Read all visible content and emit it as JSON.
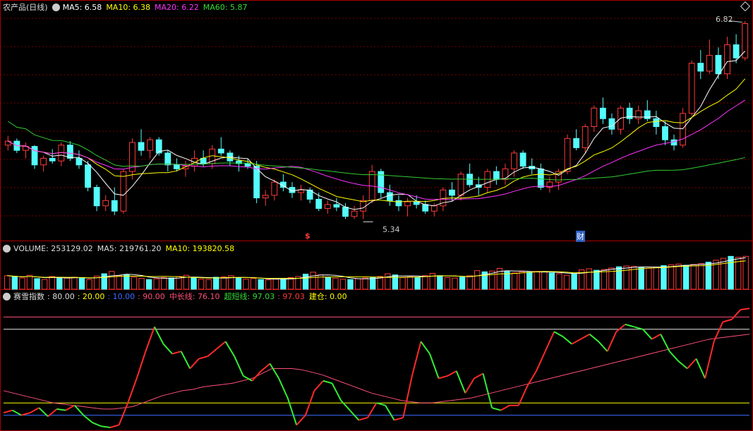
{
  "header": {
    "title": "农产品(日线)",
    "ma5": "MA5: 6.58",
    "ma10": "MA10: 6.38",
    "ma20": "MA20: 6.22",
    "ma60": "MA60: 5.87"
  },
  "volume_header": {
    "title": "VOLUME: 253129.02",
    "ma5": "MA5: 219761.20",
    "ma10": "MA10: 193820.58"
  },
  "indicator_header": {
    "title": "赛雪指数",
    "v1": ": 80.00",
    "v2": ": 20.00",
    "v3": ": 10.00",
    "v4": ": 90.00",
    "mid": "中长线: 76.10",
    "short": "超短线: 97.03",
    "short2": ": 97.03",
    "build": "建仓: 0.00"
  },
  "markers": {
    "dollar": "$",
    "cai": "财"
  },
  "colors": {
    "up": "#ff3a3a",
    "down": "#54fcfc",
    "ma5": "#ffffff",
    "ma10": "#ffff00",
    "ma20": "#ff33ff",
    "ma60": "#33cc33",
    "grid": "#7a0000"
  },
  "chart_data": [
    {
      "type": "candlestick",
      "title": "农产品(日线)",
      "annotations": [
        {
          "label": "6.82",
          "index": 83,
          "value": 6.82
        },
        {
          "label": "5.34",
          "index": 40,
          "value": 5.34
        }
      ],
      "ohlc": [
        [
          5.9,
          5.97,
          5.86,
          5.93
        ],
        [
          5.93,
          5.95,
          5.84,
          5.86
        ],
        [
          5.86,
          5.92,
          5.8,
          5.89
        ],
        [
          5.89,
          5.9,
          5.72,
          5.75
        ],
        [
          5.75,
          5.82,
          5.7,
          5.8
        ],
        [
          5.8,
          5.87,
          5.76,
          5.78
        ],
        [
          5.78,
          5.92,
          5.74,
          5.9
        ],
        [
          5.9,
          5.93,
          5.78,
          5.8
        ],
        [
          5.8,
          5.86,
          5.72,
          5.75
        ],
        [
          5.75,
          5.78,
          5.55,
          5.58
        ],
        [
          5.58,
          5.6,
          5.4,
          5.44
        ],
        [
          5.44,
          5.52,
          5.4,
          5.48
        ],
        [
          5.48,
          5.58,
          5.37,
          5.4
        ],
        [
          5.4,
          5.72,
          5.38,
          5.7
        ],
        [
          5.7,
          5.95,
          5.64,
          5.92
        ],
        [
          5.92,
          6.02,
          5.82,
          5.86
        ],
        [
          5.86,
          5.96,
          5.8,
          5.94
        ],
        [
          5.94,
          5.96,
          5.82,
          5.84
        ],
        [
          5.84,
          5.86,
          5.7,
          5.75
        ],
        [
          5.75,
          5.8,
          5.7,
          5.72
        ],
        [
          5.72,
          5.78,
          5.66,
          5.74
        ],
        [
          5.74,
          5.86,
          5.7,
          5.8
        ],
        [
          5.8,
          5.86,
          5.74,
          5.76
        ],
        [
          5.76,
          5.9,
          5.72,
          5.87
        ],
        [
          5.87,
          5.96,
          5.82,
          5.84
        ],
        [
          5.84,
          5.86,
          5.74,
          5.78
        ],
        [
          5.78,
          5.82,
          5.7,
          5.76
        ],
        [
          5.76,
          5.8,
          5.72,
          5.74
        ],
        [
          5.74,
          5.78,
          5.46,
          5.5
        ],
        [
          5.5,
          5.56,
          5.44,
          5.52
        ],
        [
          5.52,
          5.64,
          5.48,
          5.62
        ],
        [
          5.62,
          5.68,
          5.55,
          5.58
        ],
        [
          5.58,
          5.62,
          5.5,
          5.54
        ],
        [
          5.54,
          5.6,
          5.48,
          5.56
        ],
        [
          5.56,
          5.58,
          5.46,
          5.49
        ],
        [
          5.49,
          5.54,
          5.4,
          5.42
        ],
        [
          5.42,
          5.48,
          5.38,
          5.45
        ],
        [
          5.45,
          5.5,
          5.4,
          5.43
        ],
        [
          5.43,
          5.46,
          5.34,
          5.36
        ],
        [
          5.36,
          5.44,
          5.34,
          5.4
        ],
        [
          5.4,
          5.52,
          5.34,
          5.48
        ],
        [
          5.48,
          5.75,
          5.46,
          5.7
        ],
        [
          5.7,
          5.72,
          5.5,
          5.54
        ],
        [
          5.54,
          5.6,
          5.44,
          5.48
        ],
        [
          5.48,
          5.52,
          5.4,
          5.44
        ],
        [
          5.44,
          5.5,
          5.36,
          5.47
        ],
        [
          5.47,
          5.52,
          5.42,
          5.45
        ],
        [
          5.45,
          5.48,
          5.38,
          5.4
        ],
        [
          5.4,
          5.46,
          5.36,
          5.44
        ],
        [
          5.44,
          5.58,
          5.4,
          5.56
        ],
        [
          5.56,
          5.62,
          5.48,
          5.52
        ],
        [
          5.52,
          5.7,
          5.48,
          5.68
        ],
        [
          5.68,
          5.76,
          5.58,
          5.6
        ],
        [
          5.6,
          5.66,
          5.52,
          5.58
        ],
        [
          5.58,
          5.72,
          5.54,
          5.7
        ],
        [
          5.7,
          5.74,
          5.6,
          5.64
        ],
        [
          5.64,
          5.76,
          5.6,
          5.72
        ],
        [
          5.72,
          5.86,
          5.66,
          5.84
        ],
        [
          5.84,
          5.86,
          5.72,
          5.74
        ],
        [
          5.74,
          5.8,
          5.68,
          5.72
        ],
        [
          5.72,
          5.76,
          5.56,
          5.58
        ],
        [
          5.58,
          5.66,
          5.54,
          5.62
        ],
        [
          5.62,
          5.72,
          5.56,
          5.7
        ],
        [
          5.7,
          5.98,
          5.68,
          5.95
        ],
        [
          5.95,
          6.02,
          5.86,
          5.88
        ],
        [
          5.88,
          6.06,
          5.84,
          6.04
        ],
        [
          6.04,
          6.2,
          6.0,
          6.18
        ],
        [
          6.18,
          6.26,
          6.06,
          6.1
        ],
        [
          6.1,
          6.14,
          5.98,
          6.02
        ],
        [
          6.02,
          6.2,
          5.98,
          6.18
        ],
        [
          6.18,
          6.22,
          6.06,
          6.1
        ],
        [
          6.1,
          6.2,
          6.06,
          6.16
        ],
        [
          6.16,
          6.24,
          6.08,
          6.1
        ],
        [
          6.1,
          6.16,
          5.98,
          6.04
        ],
        [
          6.04,
          6.08,
          5.9,
          5.94
        ],
        [
          5.94,
          5.98,
          5.86,
          5.9
        ],
        [
          5.9,
          6.18,
          5.88,
          6.14
        ],
        [
          6.14,
          6.54,
          6.12,
          6.52
        ],
        [
          6.52,
          6.62,
          6.4,
          6.46
        ],
        [
          6.46,
          6.7,
          6.44,
          6.58
        ],
        [
          6.58,
          6.64,
          6.4,
          6.44
        ],
        [
          6.44,
          6.72,
          6.4,
          6.66
        ],
        [
          6.66,
          6.74,
          6.52,
          6.56
        ],
        [
          6.56,
          6.84,
          6.54,
          6.82
        ]
      ]
    },
    {
      "type": "bar",
      "title": "VOLUME: 253129.02",
      "values": [
        70,
        64,
        58,
        72,
        55,
        50,
        66,
        60,
        58,
        62,
        57,
        50,
        68,
        80,
        92,
        70,
        76,
        62,
        56,
        50,
        54,
        60,
        58,
        66,
        72,
        60,
        52,
        50,
        62,
        64,
        70,
        58,
        52,
        56,
        50,
        48,
        54,
        52,
        60,
        66,
        78,
        88,
        74,
        62,
        56,
        52,
        50,
        54,
        58,
        62,
        66,
        80,
        74,
        60,
        64,
        62,
        70,
        82,
        70,
        60,
        58,
        62,
        70,
        96,
        90,
        94,
        108,
        92,
        84,
        90,
        88,
        92,
        90,
        84,
        80,
        72,
        78,
        100,
        106,
        98,
        102,
        110,
        116,
        120,
        118,
        112,
        108,
        115,
        122,
        126,
        130,
        124,
        128,
        132,
        140,
        150,
        160,
        170,
        165,
        170
      ]
    },
    {
      "type": "line",
      "title": "赛雪指数",
      "series": [
        {
          "name": "中长线",
          "values": [
            30,
            28,
            26,
            24,
            22,
            20,
            19,
            18,
            17,
            16,
            15,
            15,
            16,
            17,
            20,
            23,
            26,
            28,
            30,
            31,
            33,
            34,
            35,
            36,
            38,
            40,
            44,
            48,
            48,
            48,
            47,
            45,
            43,
            40,
            37,
            34,
            31,
            28,
            26,
            24,
            22,
            21,
            20,
            20,
            21,
            22,
            23,
            24,
            26,
            28,
            30,
            32,
            34,
            36,
            38,
            40,
            42,
            44,
            46,
            48,
            50,
            52,
            54,
            56,
            58,
            60,
            62,
            64,
            66,
            68,
            70,
            72,
            73,
            74,
            75,
            76
          ]
        },
        {
          "name": "超短线",
          "values": [
            12,
            14,
            10,
            12,
            16,
            9,
            15,
            14,
            18,
            10,
            4,
            1,
            0,
            2,
            20,
            40,
            62,
            82,
            68,
            60,
            62,
            48,
            56,
            58,
            64,
            70,
            58,
            42,
            38,
            46,
            52,
            40,
            24,
            2,
            10,
            30,
            38,
            36,
            22,
            14,
            6,
            8,
            20,
            18,
            6,
            8,
            42,
            70,
            60,
            40,
            42,
            46,
            28,
            40,
            44,
            16,
            14,
            18,
            18,
            34,
            46,
            62,
            78,
            74,
            68,
            72,
            76,
            70,
            62,
            78,
            84,
            82,
            80,
            72,
            76,
            62,
            54,
            48,
            56,
            40,
            70,
            86,
            88,
            96,
            97
          ]
        }
      ],
      "values_text": [
        "80.00",
        "20.00",
        "10.00",
        "90.00"
      ]
    }
  ]
}
